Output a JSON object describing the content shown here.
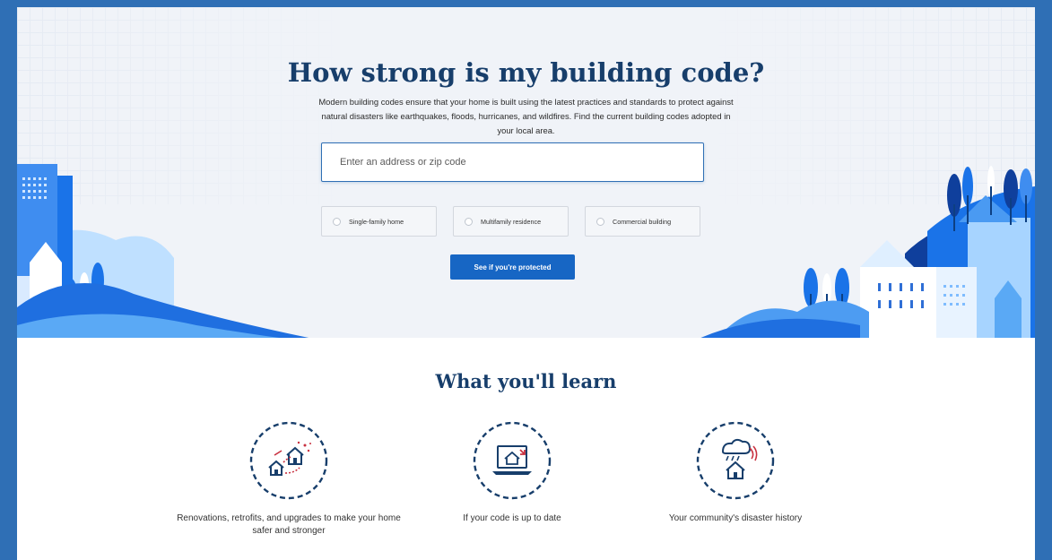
{
  "hero": {
    "title": "How strong is my building code?",
    "description": "Modern building codes ensure that your home is built using the latest practices and standards to protect against natural disasters like earthquakes, floods, hurricanes, and wildfires. Find the current building codes adopted in your local area.",
    "search": {
      "placeholder": "Enter an address or zip code",
      "value": ""
    },
    "options": [
      {
        "label": "Single-family home",
        "selected": false
      },
      {
        "label": "Multifamily residence",
        "selected": false
      },
      {
        "label": "Commercial building",
        "selected": false
      }
    ],
    "cta_label": "See if you're protected"
  },
  "learn": {
    "title": "What you'll learn",
    "features": [
      {
        "icon": "home-upgrade-icon",
        "label": "Renovations, retrofits, and upgrades to make your home safer and stronger"
      },
      {
        "icon": "laptop-home-icon",
        "label": "If your code is up to date"
      },
      {
        "icon": "storm-house-icon",
        "label": "Your community's disaster history"
      }
    ]
  },
  "colors": {
    "frame": "#2f6fb5",
    "heading": "#173e6b",
    "button": "#1766c4",
    "hero_bg": "#f0f3f8",
    "icon_accent": "#c8303f"
  }
}
